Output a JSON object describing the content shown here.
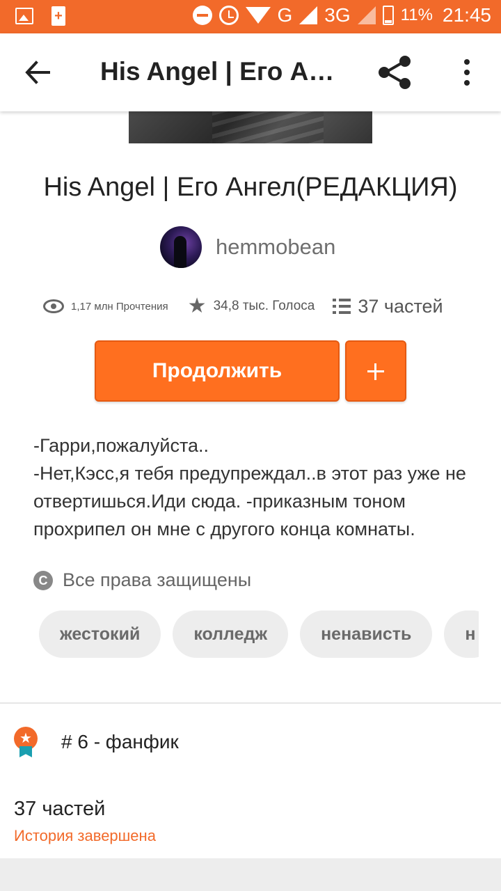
{
  "status_bar": {
    "battery_percent": "11%",
    "time": "21:45",
    "network_g": "G",
    "network_3g": "3G",
    "icons": [
      "image-icon",
      "plus-icon",
      "dnd-icon",
      "alarm-icon",
      "wifi-icon",
      "signal-icon",
      "battery-icon"
    ]
  },
  "app_bar": {
    "title": "His Angel | Его Ангел(РЕДАКЦИЯ)",
    "icons": [
      "back-arrow-icon",
      "share-icon",
      "more-vert-icon"
    ]
  },
  "story": {
    "title": "His Angel | Его Ангел(РЕДАКЦИЯ)",
    "author": "hemmobean",
    "stats": {
      "reads": "1,17 млн Прочтения",
      "votes": "34,8 тыс. Голоса",
      "parts": "37 частей"
    },
    "continue_label": "Продолжить",
    "description": "-Гарри,пожалуйста..\n-Нет,Кэсс,я тебя предупреждал..в этот раз уже не отвертишься.Иди сюда. -приказным тоном прохрипел он мне с другого конца комнаты.",
    "copyright": "Все права защищены",
    "tags": [
      "жестокий",
      "колледж",
      "ненависть",
      "н"
    ]
  },
  "rank": {
    "text": "# 6 - фанфик"
  },
  "parts_section": {
    "count": "37 частей",
    "status": "История завершена"
  },
  "colors": {
    "accent": "#f26a2a",
    "button": "#ff6f1f",
    "tag_bg": "#ededed",
    "ribbon": "#1a9fb0"
  }
}
